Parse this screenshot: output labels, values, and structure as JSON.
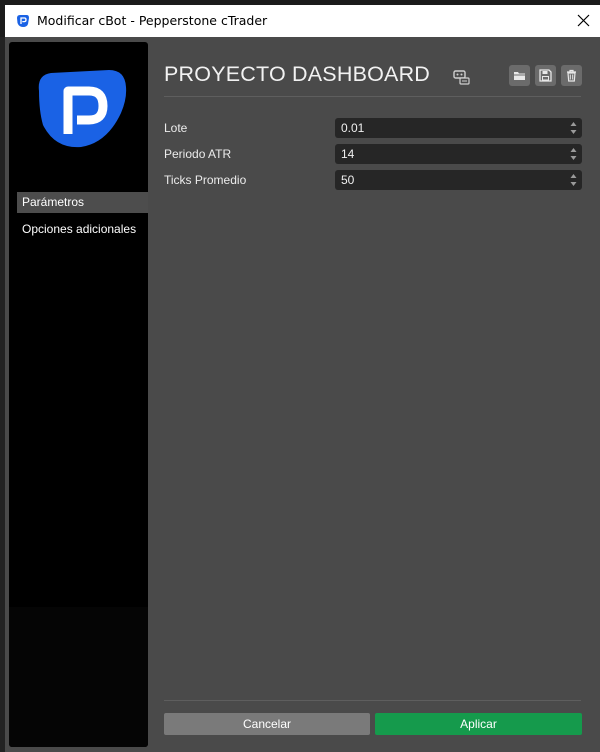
{
  "window": {
    "title": "Modificar cBot - Pepperstone cTrader",
    "icon": "pepperstone-logo-icon",
    "close_icon": "close-icon"
  },
  "sidebar": {
    "logo": "pepperstone-logo",
    "items": [
      {
        "label": "Parámetros",
        "active": true
      },
      {
        "label": "Opciones adicionales",
        "active": false
      }
    ]
  },
  "header": {
    "title": "PROYECTO DASHBOARD",
    "title_icon": "cbot-icon",
    "tools": [
      {
        "name": "open-folder-icon"
      },
      {
        "name": "save-icon"
      },
      {
        "name": "delete-icon"
      }
    ]
  },
  "parameters": [
    {
      "label": "Lote",
      "value": "0.01"
    },
    {
      "label": "Periodo ATR",
      "value": "14"
    },
    {
      "label": "Ticks Promedio",
      "value": "50"
    }
  ],
  "footer": {
    "cancel_label": "Cancelar",
    "apply_label": "Aplicar"
  },
  "colors": {
    "brand_blue": "#1a62e5",
    "apply_green": "#159a4c",
    "panel_bg": "#4a4a4a"
  }
}
